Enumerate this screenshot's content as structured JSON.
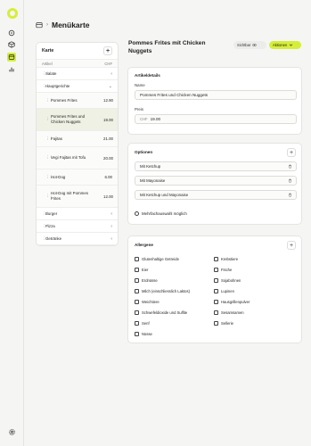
{
  "header": {
    "title": "Menükarte",
    "separator": "›"
  },
  "rail": {
    "icons": [
      "home-icon",
      "box-icon",
      "menu-card-icon",
      "stats-icon"
    ],
    "bottom_icon": "gear-icon"
  },
  "menu": {
    "title": "Karte",
    "add_label": "+",
    "col_item": "Artikel",
    "col_price": "CHF",
    "rows": [
      {
        "type": "cat",
        "name": "Salate",
        "open": false
      },
      {
        "type": "cat",
        "name": "Hauptgerichte",
        "open": true
      },
      {
        "type": "item",
        "name": "Pommes Frites",
        "price": "12.90"
      },
      {
        "type": "item",
        "name": "Pommes Frites und Chicken Nuggets",
        "price": "19.00",
        "selected": true
      },
      {
        "type": "item",
        "name": "Fajitas",
        "price": "21.00"
      },
      {
        "type": "item",
        "name": "Vegi Fajitas mit Tofu",
        "price": "20.00"
      },
      {
        "type": "item",
        "name": "Hot-Dog",
        "price": "6.00"
      },
      {
        "type": "item",
        "name": "Hot-Dog mit Pommes Frites",
        "price": "12.00"
      },
      {
        "type": "cat",
        "name": "Burger",
        "open": false
      },
      {
        "type": "cat",
        "name": "Pizza",
        "open": false
      },
      {
        "type": "cat",
        "name": "Getränke",
        "open": false
      }
    ]
  },
  "dish": {
    "title": "Pommes Frites mit Chicken Nuggets",
    "visibility_label": "Sichtbar",
    "actions_label": "Aktionen"
  },
  "details": {
    "section_title": "Artikeldetails",
    "name_label": "Name",
    "name_value": "Pommes Frites und Chicken Nuggets",
    "price_label": "Preis",
    "currency": "CHF",
    "price_value": "19.00"
  },
  "options": {
    "section_title": "Optionen",
    "add_label": "+",
    "items": [
      "Mit Ketchup",
      "Mit Mayonaise",
      "Mit Ketchup und Mayonaise"
    ],
    "multi_label": "Mehrfachauswahl möglich"
  },
  "allergens": {
    "section_title": "Allergene",
    "add_label": "+",
    "left": [
      "Glutenhaltige Getreide",
      "Eier",
      "Erdnüsse",
      "Milch (einschliesslich Laktos)",
      "Weichtiere",
      "Schwefeldioxide und Sulfite",
      "Senf",
      "Nüsse"
    ],
    "right": [
      "Krebstiere",
      "Fische",
      "Sojabohnen",
      "Lupinen",
      "Hausgrillenpulver",
      "Sesamsamen",
      "Sellerie"
    ]
  },
  "colors": {
    "accent": "#d6ee3a",
    "background": "#f5f5f3"
  }
}
